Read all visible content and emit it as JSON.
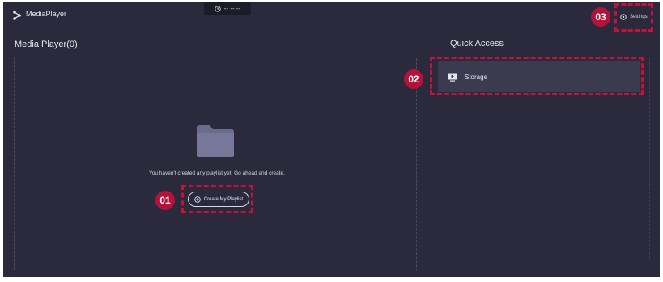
{
  "app": {
    "title": "MediaPlayer"
  },
  "clock": {
    "text": "-- -- --"
  },
  "settings": {
    "label": "Settings"
  },
  "media_player": {
    "heading": "Media Player(0)",
    "empty_message": "You haven't created any playlist yet. Go ahead and create.",
    "create_button_label": "Create My Playlist"
  },
  "quick_access": {
    "heading": "Quick Access",
    "items": [
      {
        "label": "Storage",
        "icon": "storage-icon"
      }
    ]
  },
  "callouts": [
    {
      "number": "01"
    },
    {
      "number": "02"
    },
    {
      "number": "03"
    }
  ],
  "colors": {
    "background": "#2a2a3c",
    "callout": "#b5123a",
    "panel": "#3b3b4f"
  }
}
